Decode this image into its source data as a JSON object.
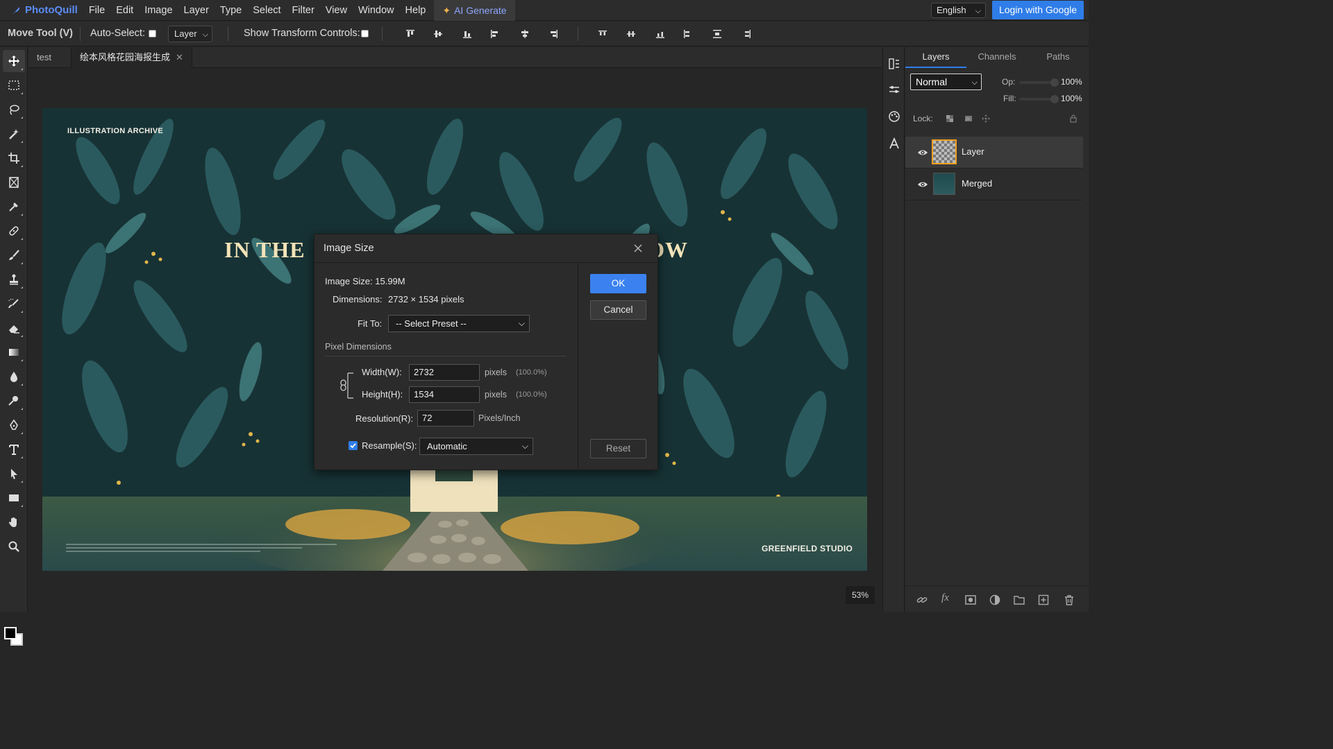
{
  "app": {
    "name": "PhotoQuill",
    "menu": [
      "File",
      "Edit",
      "Image",
      "Layer",
      "Type",
      "Select",
      "Filter",
      "View",
      "Window",
      "Help"
    ],
    "ai_generate": "AI Generate",
    "language": "English",
    "login": "Login with Google"
  },
  "options": {
    "tool": "Move Tool (V)",
    "auto_select": "Auto-Select:",
    "auto_select_target": "Layer",
    "transform_controls": "Show Transform Controls:"
  },
  "tabs": [
    "test",
    "绘本风格花园海报生成"
  ],
  "canvas": {
    "archive": "ILLUSTRATION ARCHIVE",
    "title_left": "IN THE",
    "title_right": "OW",
    "studio": "GREENFIELD STUDIO",
    "zoom": "53%"
  },
  "layers_panel": {
    "tabs": [
      "Layers",
      "Channels",
      "Paths"
    ],
    "blend_mode": "Normal",
    "opacity_label": "Op:",
    "opacity": "100%",
    "fill_label": "Fill:",
    "fill": "100%",
    "lock_label": "Lock:",
    "layers": [
      {
        "name": "Layer",
        "selected": true
      },
      {
        "name": "Merged",
        "selected": false
      }
    ]
  },
  "dialog": {
    "title": "Image Size",
    "image_size": "Image Size: 15.99M",
    "dimensions_label": "Dimensions:",
    "dimensions_value": "2732 × 1534 pixels",
    "fit_to_label": "Fit To:",
    "fit_to_value": "-- Select Preset --",
    "section": "Pixel Dimensions",
    "width_label": "Width(W):",
    "width_value": "2732",
    "width_unit": "pixels",
    "width_pct": "(100.0%)",
    "height_label": "Height(H):",
    "height_value": "1534",
    "height_unit": "pixels",
    "height_pct": "(100.0%)",
    "resolution_label": "Resolution(R):",
    "resolution_value": "72",
    "resolution_unit": "Pixels/Inch",
    "resample_label": "Resample(S):",
    "resample_value": "Automatic",
    "ok": "OK",
    "cancel": "Cancel",
    "reset": "Reset"
  },
  "colors": {
    "accent": "#2f7de8",
    "panel_bg": "#2c2c2c",
    "workspace_bg": "#262626",
    "canvas_bg": "#173235"
  }
}
